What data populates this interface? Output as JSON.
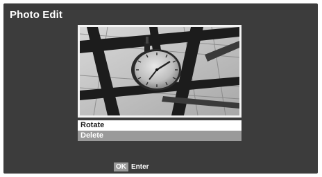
{
  "header": {
    "title": "Photo Edit"
  },
  "preview": {
    "icon": "clock-photo"
  },
  "menu": {
    "items": [
      {
        "label": "Rotate",
        "selected": true
      },
      {
        "label": "Delete",
        "selected": false
      }
    ]
  },
  "footer": {
    "key_label": "OK",
    "action_label": "Enter"
  },
  "colors": {
    "background": "#3c3c3c",
    "selected_bg": "#ffffff",
    "item_bg": "#9a9a9a"
  }
}
